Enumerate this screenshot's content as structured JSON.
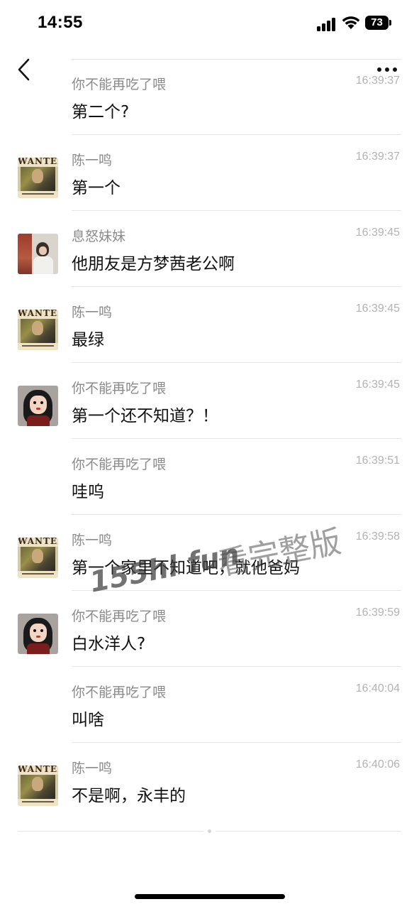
{
  "status_bar": {
    "time": "14:55",
    "battery": "73"
  },
  "nav": {
    "back_icon": "chevron-left-icon",
    "more_icon": "more-horizontal-icon"
  },
  "messages": [
    {
      "sender": "你不能再吃了喂",
      "time": "16:39:37",
      "text": "第二个?",
      "avatar": "none"
    },
    {
      "sender": "陈一鸣",
      "time": "16:39:37",
      "text": "第一个",
      "avatar": "wanted-poster"
    },
    {
      "sender": "息怒妹妹",
      "time": "16:39:45",
      "text": "他朋友是方梦茜老公啊",
      "avatar": "photo"
    },
    {
      "sender": "陈一鸣",
      "time": "16:39:45",
      "text": "最绿",
      "avatar": "wanted-poster"
    },
    {
      "sender": "你不能再吃了喂",
      "time": "16:39:45",
      "text": "第一个还不知道？！",
      "avatar": "cartoon-woman"
    },
    {
      "sender": "你不能再吃了喂",
      "time": "16:39:51",
      "text": "哇呜",
      "avatar": "none"
    },
    {
      "sender": "陈一鸣",
      "time": "16:39:58",
      "text": "第一个家里不知道吧，就他爸妈",
      "avatar": "wanted-poster"
    },
    {
      "sender": "你不能再吃了喂",
      "time": "16:39:59",
      "text": "白水洋人?",
      "avatar": "cartoon-woman"
    },
    {
      "sender": "你不能再吃了喂",
      "time": "16:40:04",
      "text": "叫啥",
      "avatar": "none"
    },
    {
      "sender": "陈一鸣",
      "time": "16:40:06",
      "text": "不是啊，永丰的",
      "avatar": "wanted-poster"
    }
  ],
  "watermark": {
    "site": "155hl fun",
    "text": "看完整版"
  }
}
